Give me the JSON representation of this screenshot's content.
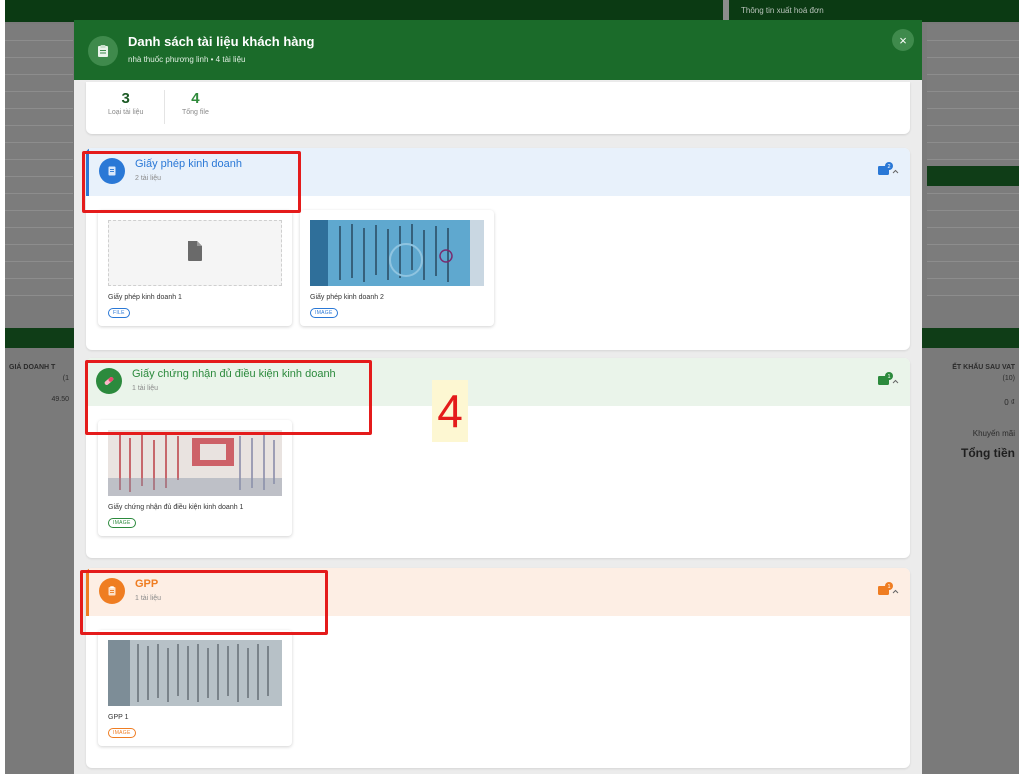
{
  "background": {
    "invoice_info_label": "Thông tin xuất hoá đơn",
    "left_header": "GIÁ DOANH T",
    "left_header_sub": "(1",
    "left_value": "49.50",
    "right_header": "ẾT KHẤU SAU VAT",
    "right_header_sub": "(10)",
    "right_value": "0 ₫",
    "promo_label": "Khuyến mãi",
    "total_label": "Tổng tiền"
  },
  "modal": {
    "title": "Danh sách tài liệu khách hàng",
    "subtitle": "nhà thuốc phương linh • 4 tài liệu",
    "close_label": "×",
    "stats": [
      {
        "value": "3",
        "label": "Loại tài liệu"
      },
      {
        "value": "4",
        "label": "Tổng file"
      }
    ],
    "sections": [
      {
        "title": "Giấy phép kinh doanh",
        "count": "2 tài liệu",
        "badge": "2",
        "color": "#2a78d6",
        "icon": "document-icon",
        "documents": [
          {
            "name": "Giấy phép kinh doanh 1",
            "tag": "FILE",
            "thumb": "placeholder"
          },
          {
            "name": "Giấy phép kinh doanh 2",
            "tag": "IMAGE",
            "thumb": "scan-blue"
          }
        ]
      },
      {
        "title": "Giấy chứng nhận đủ điều kiện kinh doanh",
        "count": "1 tài liệu",
        "badge": "1",
        "color": "#2c8a3d",
        "icon": "pill-icon",
        "documents": [
          {
            "name": "Giấy chứng nhận đủ điều kiện kinh doanh 1",
            "tag": "IMAGE",
            "thumb": "scan-red"
          }
        ]
      },
      {
        "title": "GPP",
        "count": "1 tài liệu",
        "badge": "1",
        "color": "#ef7d22",
        "icon": "clipboard-icon",
        "documents": [
          {
            "name": "GPP 1",
            "tag": "IMAGE",
            "thumb": "scan-gray"
          }
        ]
      }
    ]
  },
  "annotation": {
    "step_number": "4"
  }
}
